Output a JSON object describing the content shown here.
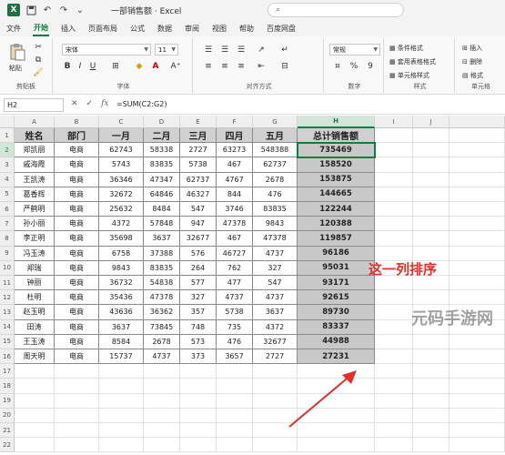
{
  "titlebar": {
    "app_logo": "X",
    "doc_title": "一部销售额 · Excel",
    "icons": [
      "save-icon",
      "undo-icon",
      "redo-icon"
    ],
    "search_icon": "search-icon"
  },
  "menu": {
    "tabs": [
      {
        "label": "文件",
        "active": false
      },
      {
        "label": "开始",
        "active": true
      },
      {
        "label": "插入",
        "active": false
      },
      {
        "label": "页面布局",
        "active": false
      },
      {
        "label": "公式",
        "active": false
      },
      {
        "label": "数据",
        "active": false
      },
      {
        "label": "审阅",
        "active": false
      },
      {
        "label": "视图",
        "active": false
      },
      {
        "label": "帮助",
        "active": false
      },
      {
        "label": "百度网盘",
        "active": false
      }
    ]
  },
  "ribbon": {
    "clipboard": {
      "paste_label": "粘贴",
      "group_label": "剪贴板"
    },
    "font": {
      "font_name": "宋体",
      "font_size": "11",
      "group_label": "字体",
      "bold": "B",
      "italic": "I",
      "underline": "U"
    },
    "alignment": {
      "group_label": "对齐方式"
    },
    "number": {
      "format": "常规",
      "group_label": "数字",
      "percent": "%",
      "comma": "9"
    },
    "styles": {
      "cond_format": "条件格式",
      "table_format": "套用表格格式",
      "cell_styles": "单元格样式",
      "group_label": "样式"
    },
    "cells": {
      "insert": "插入",
      "delete": "删除",
      "format": "格式",
      "group_label": "单元格"
    }
  },
  "formula_bar": {
    "name_box": "H2",
    "formula": "=SUM(C2:G2)"
  },
  "sheet": {
    "col_letters": [
      "A",
      "B",
      "C",
      "D",
      "E",
      "F",
      "G",
      "H",
      "I",
      "J"
    ],
    "row_numbers": [
      "1",
      "2",
      "3",
      "4",
      "5",
      "6",
      "7",
      "8",
      "9",
      "10",
      "11",
      "12",
      "13",
      "14",
      "15",
      "16",
      "17",
      "18",
      "19",
      "20",
      "21",
      "22"
    ],
    "headers": [
      "姓名",
      "部门",
      "一月",
      "二月",
      "三月",
      "四月",
      "五月",
      "总计销售额"
    ],
    "rows": [
      [
        "郑凯丽",
        "电商",
        "62743",
        "58338",
        "2727",
        "63273",
        "548388",
        "735469"
      ],
      [
        "戚海霞",
        "电商",
        "5743",
        "83835",
        "5738",
        "467",
        "62737",
        "158520"
      ],
      [
        "王凯涛",
        "电商",
        "36346",
        "47347",
        "62737",
        "4767",
        "2678",
        "153875"
      ],
      [
        "葛香辉",
        "电商",
        "32672",
        "64846",
        "46327",
        "844",
        "476",
        "144665"
      ],
      [
        "严鹤明",
        "电商",
        "25632",
        "8484",
        "547",
        "3746",
        "83835",
        "122244"
      ],
      [
        "孙小丽",
        "电商",
        "4372",
        "57848",
        "947",
        "47378",
        "9843",
        "120388"
      ],
      [
        "李正明",
        "电商",
        "35698",
        "3637",
        "32677",
        "467",
        "47378",
        "119857"
      ],
      [
        "冯玉涛",
        "电商",
        "6758",
        "37388",
        "576",
        "46727",
        "4737",
        "96186"
      ],
      [
        "郑瑞",
        "电商",
        "9843",
        "83835",
        "264",
        "762",
        "327",
        "95031"
      ],
      [
        "钟丽",
        "电商",
        "36732",
        "54838",
        "577",
        "477",
        "547",
        "93171"
      ],
      [
        "杜明",
        "电商",
        "35436",
        "47378",
        "327",
        "4737",
        "4737",
        "92615"
      ],
      [
        "赵玉明",
        "电商",
        "43636",
        "36362",
        "357",
        "5738",
        "3637",
        "89730"
      ],
      [
        "田涛",
        "电商",
        "3637",
        "73845",
        "748",
        "735",
        "4372",
        "83337"
      ],
      [
        "王玉涛",
        "电商",
        "8584",
        "2678",
        "573",
        "476",
        "32677",
        "44988"
      ],
      [
        "周天明",
        "电商",
        "15737",
        "4737",
        "373",
        "3657",
        "2727",
        "27231"
      ]
    ]
  },
  "annotation": {
    "text": "这一列排序",
    "color": "#e0302a"
  },
  "watermark": "元码手游网",
  "colors": {
    "accent": "#107c41",
    "header_fill": "#d0d0d0",
    "total_fill": "#c8c8c8"
  }
}
